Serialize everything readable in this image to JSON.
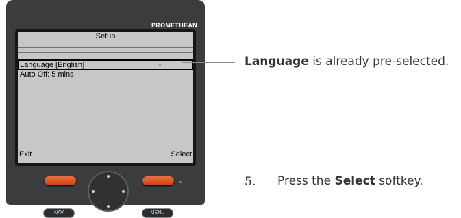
{
  "device": {
    "brand": "PROMETHEAN",
    "screen": {
      "title": "Setup",
      "menu_items": [
        {
          "label": "Language [English]",
          "selected": true
        },
        {
          "label": "Auto Off: 5 mins",
          "selected": false
        }
      ],
      "softkeys": {
        "left": "Exit",
        "right": "Select"
      }
    },
    "buttons": {
      "nav": "NAV",
      "menu": "MENU"
    }
  },
  "annotations": {
    "first": {
      "bold": "Language",
      "rest": " is already pre-selected."
    },
    "second": {
      "number": "5.",
      "prefix": "Press the ",
      "bold": "Select",
      "suffix": " softkey."
    }
  },
  "colors": {
    "softkey_accent": "#e05a2b",
    "screen_bg": "#c5c7c9",
    "device_body": "#3a3c3e"
  }
}
